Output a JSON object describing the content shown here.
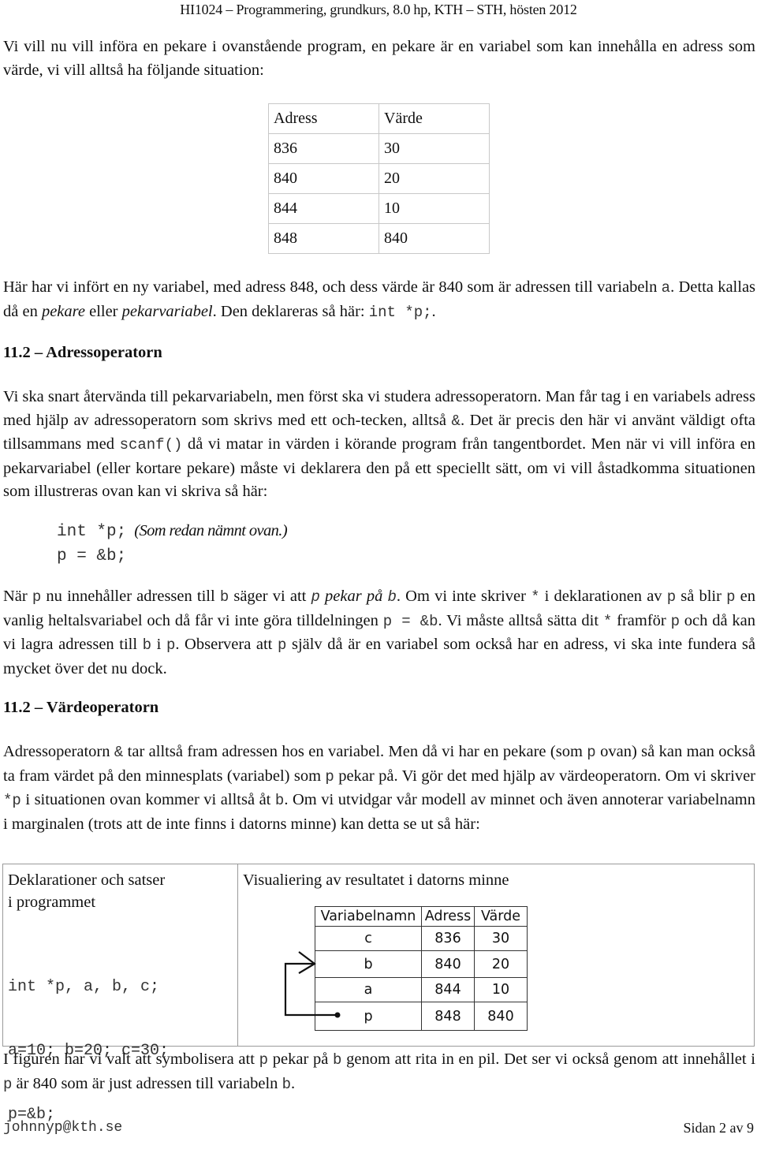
{
  "header": {
    "title": "HI1024 – Programmering, grundkurs, 8.0 hp, KTH – STH, hösten 2012"
  },
  "intro": {
    "text": "Vi vill nu vill införa en pekare i ovanstående program, en pekare är en variabel som kan innehålla en adress som värde, vi vill alltså ha följande situation:"
  },
  "memory_table": {
    "headers": [
      "Adress",
      "Värde"
    ],
    "rows": [
      [
        "836",
        "30"
      ],
      [
        "840",
        "20"
      ],
      [
        "844",
        "10"
      ],
      [
        "848",
        "840"
      ]
    ]
  },
  "explanation": {
    "line1": "Här har vi infört en ny variabel, med adress 848, och dess värde är 840 som är adressen till",
    "p2a": "variabeln ",
    "code_a": "a",
    "p2b": ". Detta kallas då en ",
    "em1": "pekare",
    "p2c": " eller ",
    "em2": "pekarvariabel",
    "p2d": ". Den deklareras så här: ",
    "code_decl": "int *p;",
    "p2e": "."
  },
  "section1": {
    "heading": "11.2 – Adressoperatorn",
    "s1": "Vi ska snart återvända till pekarvariabeln, men först ska vi studera adressoperatorn. Man får tag i en variabels adress med hjälp av adressoperatorn som skrivs med ett och-tecken, alltså ",
    "code_amp": "&",
    "s2": ". Det är precis den här vi använt väldigt ofta tillsammans med ",
    "code_scanf": "scanf()",
    "s3": " då vi matar in värden i körande program från tangentbordet. Men när vi vill införa en pekarvariabel (eller kortare pekare) måste vi deklarera den på ett speciellt sätt, om vi vill åstadkomma situationen som illustreras ovan kan vi skriva så här:"
  },
  "code_example": {
    "line1": "int *p;",
    "note": "(Som redan nämnt ovan.)",
    "line2": "p = &b;"
  },
  "pointer_para": {
    "t1": "När ",
    "c1": "p",
    "t2": " nu innehåller adressen till ",
    "c2": "b",
    "t3": " säger vi att ",
    "c3": "p",
    "em": " pekar på ",
    "c4": "b",
    "t4": ". Om vi inte skriver ",
    "c5": "*",
    "t5": " i deklarationen av ",
    "c6": "p",
    "t6": " så blir ",
    "c7": "p",
    "t7": " en vanlig heltalsvariabel och då får vi inte göra tilldelningen ",
    "c8": "p = &b",
    "t8": ". Vi måste alltså sätta dit ",
    "c9": "*",
    "t9": " framför ",
    "c10": "p",
    "t10": " och då kan vi lagra adressen till ",
    "c11": "b",
    "t11": " i ",
    "c12": "p",
    "t12": ". Observera att ",
    "c13": "p",
    "t13": " själv då är en variabel som också har en adress, vi ska inte fundera så mycket över det nu dock."
  },
  "section2": {
    "heading": "11.2 – Värdeoperatorn",
    "t1": "Adressoperatorn ",
    "c1": "&",
    "t2": " tar alltså fram adressen hos en variabel. Men då vi har en pekare (som ",
    "c2": "p",
    "t3": " ovan) så kan man också ta fram värdet på den minnesplats (variabel) som ",
    "c3": "p",
    "t4": " pekar på. Vi gör det med hjälp av värdeoperatorn. Om vi skriver ",
    "c4": "*p",
    "t5": " i situationen ovan kommer vi alltså åt ",
    "c5": "b",
    "t6": ". Om vi utvidgar vår modell av minnet och även annoterar variabelnamn i marginalen (trots att de inte finns i datorns minne) kan detta se ut så här:"
  },
  "figure": {
    "left_title": "Deklarationer och satser i programmet",
    "code_lines": [
      "int *p, a, b, c;",
      "a=10; b=20; c=30;",
      "p=&b;"
    ],
    "right_title": "Visualiering av resultatet i datorns minne",
    "table": {
      "headers": [
        "Variabelnamn",
        "Adress",
        "Värde"
      ],
      "rows": [
        [
          "c",
          "836",
          "30"
        ],
        [
          "b",
          "840",
          "20"
        ],
        [
          "a",
          "844",
          "10"
        ],
        [
          "p",
          "848",
          "840"
        ]
      ]
    },
    "arrow": {
      "from": "p",
      "to": "b",
      "icon": "pointer-arrow"
    }
  },
  "caption": {
    "t1": "I figuren har vi valt att symbolisera att ",
    "c1": "p",
    "t2": " pekar på ",
    "c2": "b",
    "t3": " genom att rita in en pil. Det ser vi också genom att innehållet i ",
    "c3": "p",
    "t4": " är 840 som är just adressen till variabeln ",
    "c4": "b",
    "t5": "."
  },
  "footer": {
    "email": "johnnyp@kth.se",
    "page": "Sidan 2 av 9"
  }
}
